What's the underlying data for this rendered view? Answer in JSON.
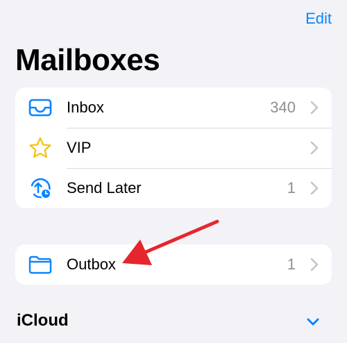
{
  "header": {
    "edit_label": "Edit",
    "title": "Mailboxes"
  },
  "mailboxes": [
    {
      "label": "Inbox",
      "count": "340",
      "icon": "inbox-tray-icon"
    },
    {
      "label": "VIP",
      "count": "",
      "icon": "star-icon"
    },
    {
      "label": "Send Later",
      "count": "1",
      "icon": "clock-arrow-icon"
    }
  ],
  "outbox": {
    "label": "Outbox",
    "count": "1",
    "icon": "folder-icon"
  },
  "sections": {
    "icloud_title": "iCloud"
  },
  "colors": {
    "accent": "#0a84ff",
    "star": "#f5c518",
    "annotation_arrow": "#e5262e"
  }
}
